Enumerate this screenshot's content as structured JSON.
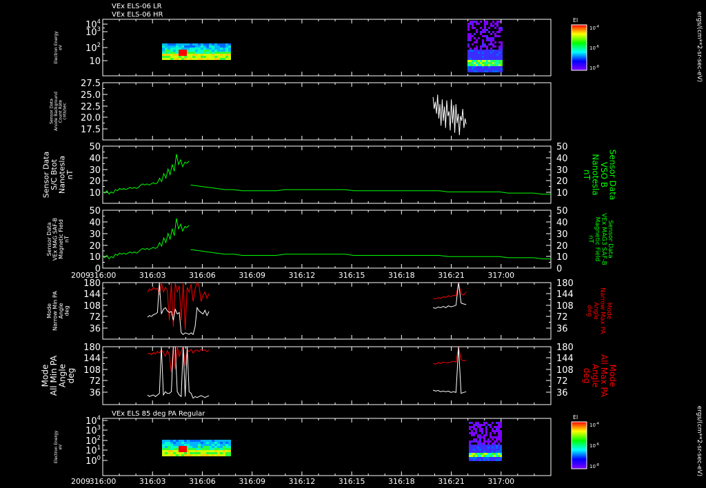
{
  "colors": {
    "background": "#000000",
    "axes": "#ffffff",
    "mag_green": "#00ff00",
    "pa_red": "#ff0000",
    "pa_white": "#ffffff"
  },
  "header": {
    "line1": "VEx ELS-06 LR",
    "line2": "VEx ELS-06 HR"
  },
  "flux_units": "ergs/(cm**2-sr-sec-eV)",
  "time_axis": {
    "year": "2009",
    "ticks": [
      "316:00",
      "316:03",
      "316:06",
      "316:09",
      "316:12",
      "316:15",
      "316:18",
      "316:21",
      "317:00"
    ]
  },
  "chart_data": [
    {
      "type": "heatmap",
      "ylabel": "Electron Energy\neV",
      "yticks": [
        "10^4",
        "10^3",
        "10^2",
        "10"
      ],
      "colorbar": {
        "title": "El",
        "ticks": [
          "10^-4",
          "10^-6",
          "10^-8"
        ]
      },
      "blocks": [
        {
          "t_start": "316:02.6",
          "t_end": "316:06.4",
          "energy_range_eV": [
            10,
            200
          ]
        },
        {
          "t_start": "316:19.8",
          "t_end": "316:21.9",
          "energy_range_eV": [
            3,
            20000
          ]
        }
      ]
    },
    {
      "type": "line",
      "ylabel": "Sensor Data\nAnode Background\nCount Rate\ncnts/sec",
      "yticks": [
        "27.5",
        "25.0",
        "22.5",
        "20.0",
        "17.5"
      ],
      "ylim": [
        15.5,
        27.5
      ],
      "series": [
        {
          "x_start": 19.9,
          "x_end": 21.9,
          "values": [
            24.5,
            22.0,
            23.5,
            21.0,
            25.0,
            20.0,
            23.0,
            18.5,
            24.0,
            19.5,
            22.5,
            18.0,
            23.8,
            20.5,
            21.5,
            17.5,
            24.0,
            19.0,
            22.8,
            17.0,
            23.0,
            19.0,
            21.0,
            16.5,
            20.5,
            19.5,
            22.0,
            18.0,
            20.0,
            18.8
          ]
        }
      ]
    },
    {
      "type": "line",
      "ylabel": "Sensor Data\nS/C Btot\nNanotesla\nnT",
      "right_label": "Sensor Data\nVSO B\nNanotesla\nnT",
      "yticks": [
        "50",
        "40",
        "30",
        "20",
        "10"
      ],
      "ylim": [
        0,
        50
      ],
      "series": [
        {
          "x_start": 0,
          "x_end": 5.2,
          "values": [
            10,
            9,
            11,
            8,
            10,
            9,
            12,
            11,
            13,
            12,
            13,
            12,
            13,
            14,
            13,
            14,
            13,
            14,
            16,
            17,
            16,
            17,
            16,
            17,
            18,
            17,
            18,
            22,
            19,
            26,
            22,
            30,
            25,
            34,
            28,
            43,
            34,
            38,
            32,
            36,
            35,
            37
          ]
        },
        {
          "x_start": 5.3,
          "x_end": 27,
          "values": [
            16,
            15,
            14,
            13,
            12,
            12,
            11,
            11,
            11,
            11,
            11,
            12,
            12,
            12,
            12,
            12,
            12,
            12,
            12,
            11,
            11,
            11,
            11,
            11,
            11,
            11,
            11,
            11,
            11,
            11,
            10,
            10,
            10,
            10,
            10,
            10,
            10,
            9,
            9,
            9,
            9,
            8,
            8
          ]
        }
      ]
    },
    {
      "type": "line",
      "ylabel": "Sensor Data\nVEx MAG SAF-B\nMagnetic Field\nnT",
      "right_label": "Sensor Data\nVEx MAG3 SAF-B\nMagnetic Field\nnT",
      "yticks": [
        "50",
        "40",
        "30",
        "20",
        "10",
        "0"
      ],
      "ylim": [
        0,
        50
      ],
      "series": [
        {
          "x_start": 0,
          "x_end": 5.2,
          "values": [
            10,
            9,
            11,
            8,
            10,
            9,
            12,
            11,
            13,
            12,
            13,
            12,
            13,
            14,
            13,
            14,
            13,
            14,
            16,
            17,
            16,
            17,
            16,
            17,
            18,
            17,
            18,
            22,
            19,
            26,
            22,
            30,
            25,
            34,
            28,
            43,
            34,
            38,
            32,
            36,
            35,
            37
          ]
        },
        {
          "x_start": 5.3,
          "x_end": 27,
          "values": [
            16,
            15,
            14,
            13,
            12,
            12,
            11,
            11,
            11,
            11,
            11,
            12,
            12,
            12,
            12,
            12,
            12,
            12,
            12,
            11,
            11,
            11,
            11,
            11,
            11,
            11,
            11,
            11,
            11,
            11,
            10,
            10,
            10,
            10,
            10,
            10,
            10,
            9,
            9,
            9,
            9,
            8,
            8
          ]
        }
      ]
    },
    {
      "type": "line",
      "ylabel": "Mode\nNarrow Min PA\nAngle\ndeg",
      "right_label": "Mode\nNarrow Max PA\nAngle\ndeg",
      "yticks": [
        "180",
        "144",
        "108",
        "72",
        "36"
      ],
      "ylim": [
        0,
        180
      ],
      "series": [
        {
          "color": "#ff0000",
          "x_start": 2.7,
          "x_end": 6.4,
          "values": [
            150,
            160,
            155,
            165,
            158,
            162,
            140,
            180,
            150,
            165,
            155,
            60,
            180,
            40,
            178,
            150,
            170,
            60,
            180,
            30,
            165,
            150,
            175,
            120,
            160,
            180,
            170,
            120,
            140,
            150,
            130,
            145
          ]
        },
        {
          "color": "#ffffff",
          "x_start": 2.7,
          "x_end": 6.4,
          "values": [
            70,
            75,
            72,
            78,
            80,
            85,
            180,
            80,
            95,
            100,
            90,
            85,
            88,
            60,
            95,
            80,
            85,
            20,
            15,
            20,
            18,
            15,
            20,
            15,
            40,
            100,
            90,
            85,
            80,
            92,
            75,
            88
          ]
        },
        {
          "color": "#ff0000",
          "x_start": 19.9,
          "x_end": 21.9,
          "values": [
            130,
            128,
            132,
            130,
            135,
            133,
            138,
            135,
            140,
            138,
            180,
            145,
            140,
            150
          ]
        },
        {
          "color": "#ffffff",
          "x_start": 19.9,
          "x_end": 21.9,
          "values": [
            100,
            98,
            102,
            100,
            104,
            100,
            106,
            103,
            105,
            108,
            180,
            115,
            112,
            110
          ]
        }
      ]
    },
    {
      "type": "line",
      "ylabel": "Mode\nAll Min PA\nAngle\ndeg",
      "right_label": "Mode\nAll Max PA\nAngle\ndeg",
      "yticks": [
        "180",
        "144",
        "108",
        "72",
        "36"
      ],
      "ylim": [
        0,
        180
      ],
      "series": [
        {
          "color": "#ff0000",
          "x_start": 2.7,
          "x_end": 6.4,
          "values": [
            158,
            160,
            155,
            162,
            158,
            165,
            160,
            170,
            162,
            150,
            168,
            155,
            100,
            180,
            110,
            180,
            150,
            165,
            180,
            120,
            170,
            165,
            172,
            160,
            168,
            170,
            165,
            172,
            168,
            170,
            165,
            170
          ]
        },
        {
          "color": "#ffffff",
          "x_start": 2.7,
          "x_end": 6.4,
          "values": [
            30,
            25,
            28,
            30,
            25,
            30,
            35,
            180,
            30,
            40,
            35,
            35,
            40,
            180,
            180,
            40,
            30,
            25,
            180,
            25,
            180,
            40,
            35,
            20,
            25,
            22,
            25,
            28,
            25,
            22,
            25,
            28
          ]
        },
        {
          "color": "#ff0000",
          "x_start": 19.9,
          "x_end": 21.9,
          "values": [
            128,
            126,
            130,
            128,
            132,
            130,
            130,
            132,
            135,
            132,
            180,
            140,
            136,
            138
          ]
        },
        {
          "color": "#ffffff",
          "x_start": 19.9,
          "x_end": 21.9,
          "values": [
            45,
            42,
            44,
            40,
            42,
            40,
            42,
            38,
            40,
            38,
            180,
            35,
            38,
            40
          ]
        }
      ]
    },
    {
      "type": "heatmap",
      "title": "VEx ELS 85 deg PA Regular",
      "ylabel": "Electron Energy\neV",
      "yticks": [
        "10^4",
        "10^3",
        "10^2",
        "10^1",
        "10^0"
      ],
      "colorbar": {
        "title": "El",
        "ticks": [
          "10^-4",
          "10^-6",
          "10^-8"
        ]
      },
      "blocks": [
        {
          "t_start": "316:02.6",
          "t_end": "316:06.4",
          "energy_range_eV": [
            2,
            200
          ]
        },
        {
          "t_start": "316:19.8",
          "t_end": "316:21.9",
          "energy_range_eV": [
            1,
            20000
          ]
        }
      ]
    }
  ]
}
